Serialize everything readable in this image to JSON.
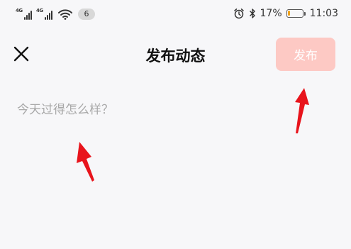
{
  "status_bar": {
    "signal_1_tag": "4G",
    "signal_2_tag": "4G",
    "notification_count": "6",
    "battery_text": "17%",
    "battery_level": 0.17,
    "time": "11:03"
  },
  "header": {
    "title": "发布动态",
    "publish_label": "发布"
  },
  "compose": {
    "placeholder": "今天过得怎么样？",
    "value": ""
  },
  "colors": {
    "publish_disabled_bg": "#fdc9c4",
    "battery_low": "#f0a21a",
    "annotation_arrow": "#e8141c"
  }
}
